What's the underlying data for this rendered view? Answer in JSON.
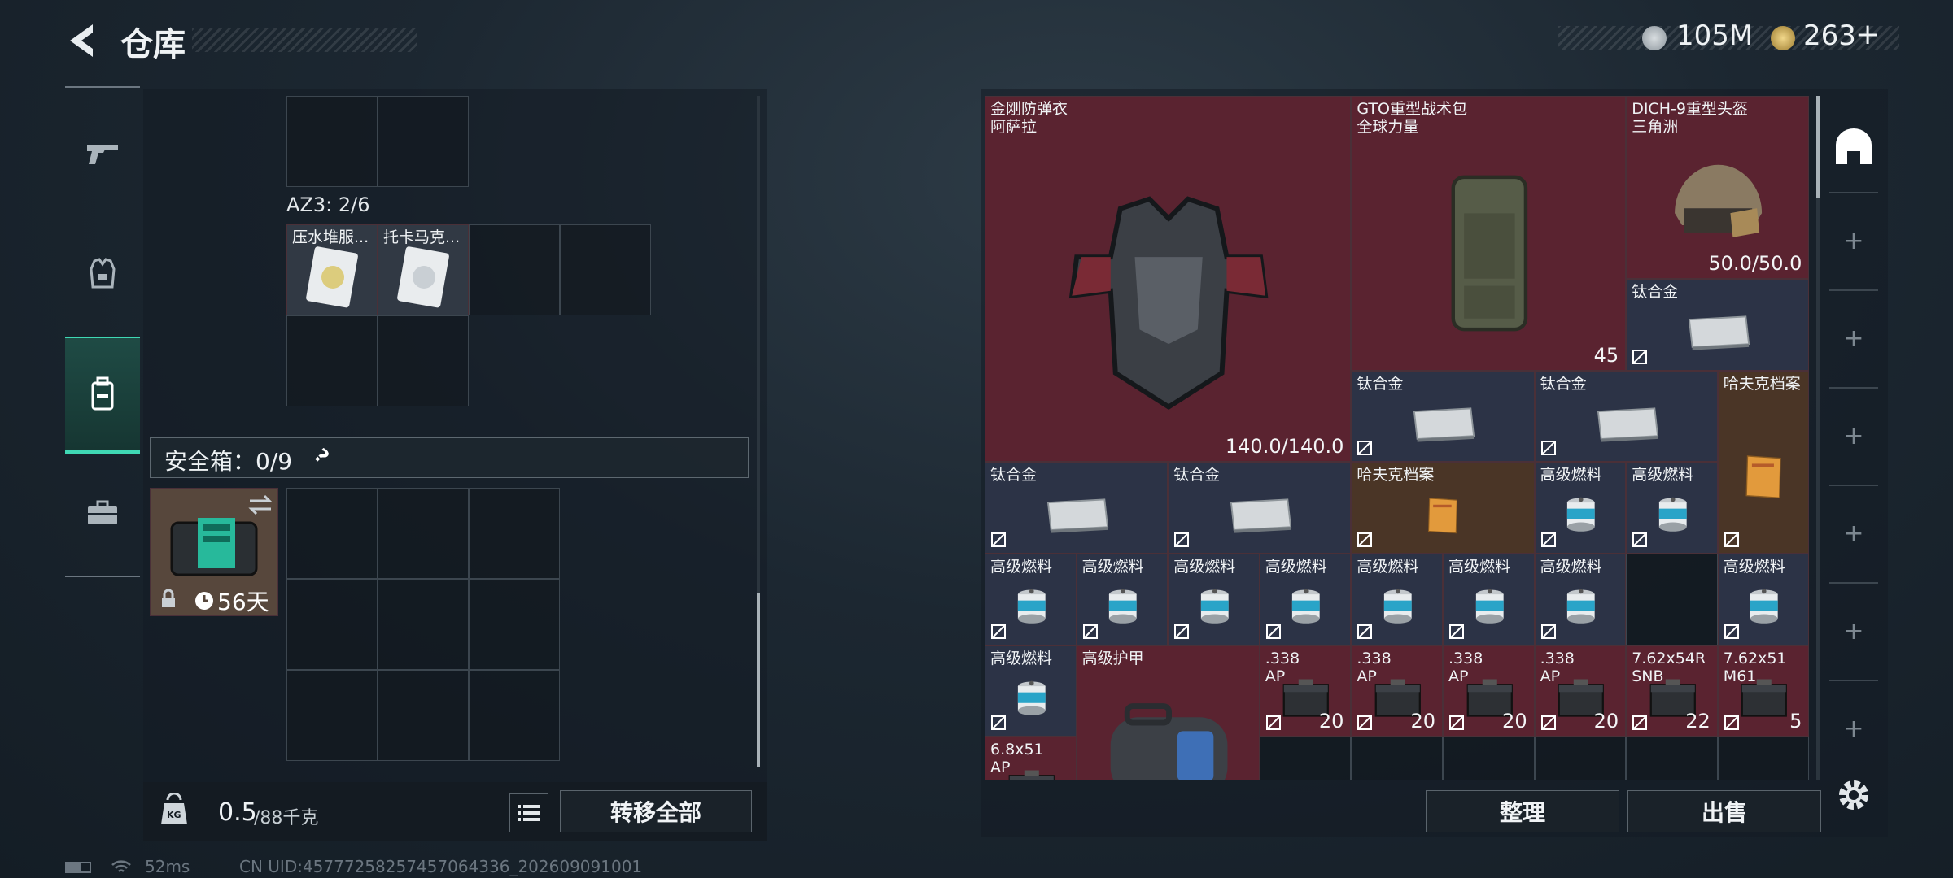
{
  "header": {
    "title": "仓库",
    "silver": "105M",
    "gold": "263",
    "gold_plus": "+"
  },
  "left": {
    "az3_label": "AZ3: 2/6",
    "az3_items": [
      {
        "name": "压水堆服..."
      },
      {
        "name": "托卡马克..."
      }
    ],
    "safebox_label": "安全箱：0/9",
    "safebox_help": "?",
    "safebox_days": "56天",
    "weight_value": "0.5",
    "weight_max": "/88千克",
    "weight_icon_label": "KG",
    "transfer_label": "转移全部"
  },
  "right": {
    "items": [
      {
        "name": "金刚防弹衣\n阿萨拉",
        "qty": "140.0/140.0",
        "color": "red",
        "icon": "body-armor"
      },
      {
        "name": "GTO重型战术包\n全球力量",
        "qty": "45",
        "color": "red",
        "icon": "backpack"
      },
      {
        "name": "DICH-9重型头盔\n三角洲",
        "qty": "50.0/50.0",
        "color": "red",
        "icon": "helmet"
      },
      {
        "name": "钛合金",
        "qty": "",
        "color": "blue",
        "icon": "titanium-plate"
      },
      {
        "name": "钛合金",
        "qty": "",
        "color": "blue",
        "icon": "titanium-plate"
      },
      {
        "name": "钛合金",
        "qty": "",
        "color": "blue",
        "icon": "titanium-plate"
      },
      {
        "name": "哈夫克档案",
        "qty": "",
        "color": "gold",
        "icon": "folder"
      },
      {
        "name": "钛合金",
        "qty": "",
        "color": "blue",
        "icon": "titanium-plate"
      },
      {
        "name": "钛合金",
        "qty": "",
        "color": "blue",
        "icon": "titanium-plate"
      },
      {
        "name": "哈夫克档案",
        "qty": "",
        "color": "gold",
        "icon": "folder"
      },
      {
        "name": "高级燃料",
        "qty": "",
        "color": "blue",
        "icon": "fuel-can"
      },
      {
        "name": "高级燃料",
        "qty": "",
        "color": "blue",
        "icon": "fuel-can"
      },
      {
        "name": "高级燃料",
        "qty": "",
        "color": "blue",
        "icon": "fuel-can"
      },
      {
        "name": "高级燃料",
        "qty": "",
        "color": "blue",
        "icon": "fuel-can"
      },
      {
        "name": "高级燃料",
        "qty": "",
        "color": "blue",
        "icon": "fuel-can"
      },
      {
        "name": "高级燃料",
        "qty": "",
        "color": "blue",
        "icon": "fuel-can"
      },
      {
        "name": "高级燃料",
        "qty": "",
        "color": "blue",
        "icon": "fuel-can"
      },
      {
        "name": "高级燃料",
        "qty": "",
        "color": "blue",
        "icon": "fuel-can"
      },
      {
        "name": "高级燃料",
        "qty": "",
        "color": "blue",
        "icon": "fuel-can"
      },
      {
        "name": "高级燃料",
        "qty": "",
        "color": "blue",
        "icon": "fuel-can"
      },
      {
        "name": "高级燃料",
        "qty": "",
        "color": "blue",
        "icon": "fuel-can"
      },
      {
        "name": "高级护甲",
        "qty": "",
        "color": "red",
        "icon": "armor-bag"
      },
      {
        "name": ".338\nAP",
        "qty": "20",
        "color": "red",
        "icon": "ammo-box"
      },
      {
        "name": ".338\nAP",
        "qty": "20",
        "color": "red",
        "icon": "ammo-box"
      },
      {
        "name": ".338\nAP",
        "qty": "20",
        "color": "red",
        "icon": "ammo-box"
      },
      {
        "name": ".338\nAP",
        "qty": "20",
        "color": "red",
        "icon": "ammo-box"
      },
      {
        "name": "7.62x54R\nSNB",
        "qty": "22",
        "color": "red",
        "icon": "ammo-box"
      },
      {
        "name": "7.62x51\nM61",
        "qty": "5",
        "color": "red",
        "icon": "ammo-box"
      },
      {
        "name": "6.8x51\nAP",
        "qty": "",
        "color": "red",
        "icon": "ammo-box"
      }
    ],
    "sort_label": "整理",
    "sell_label": "出售"
  },
  "status": {
    "ping": "52ms",
    "uid": "CN UID:457772582574570643​36_202609091001"
  }
}
